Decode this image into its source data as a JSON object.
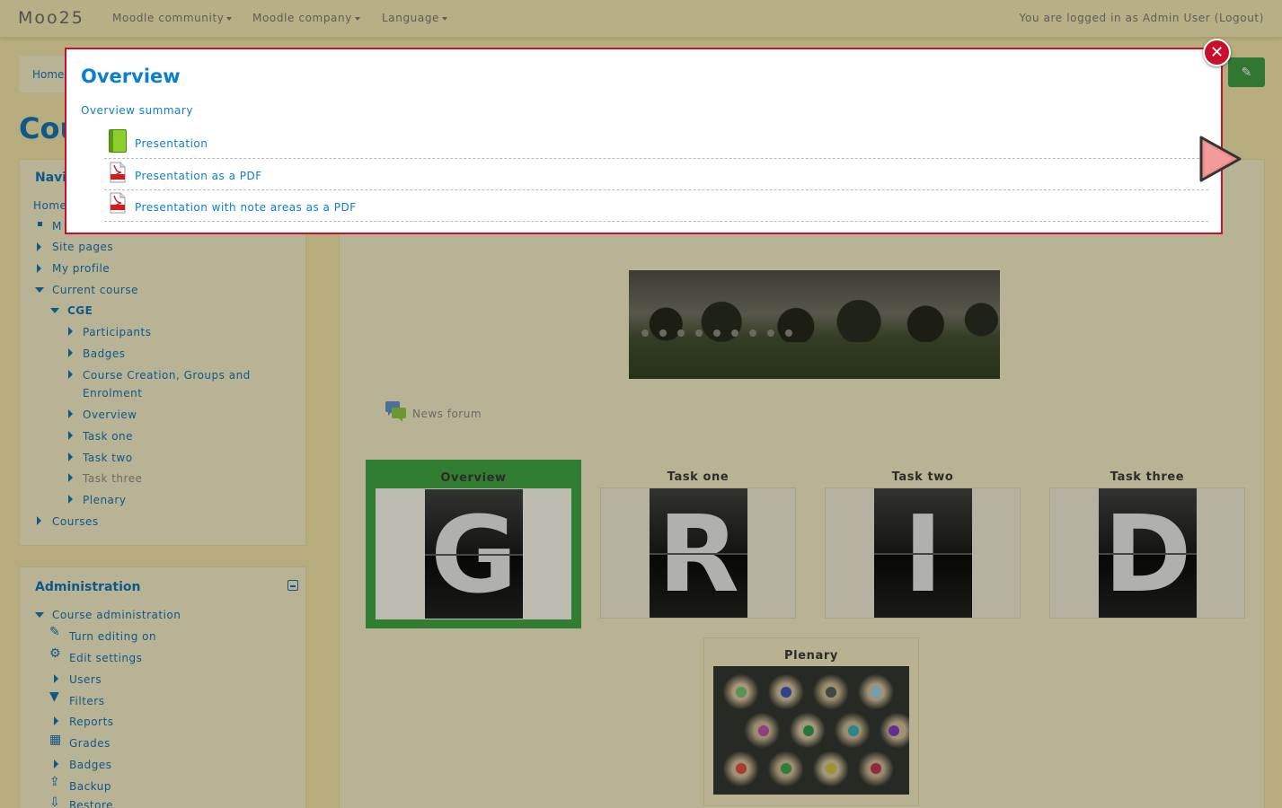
{
  "navbar": {
    "brand": "Moo25",
    "menus": [
      "Moodle community",
      "Moodle company",
      "Language"
    ],
    "login_prefix": "You are logged in as ",
    "login_user": "Admin User",
    "logout": "Logout"
  },
  "breadcrumb": {
    "home": "Home"
  },
  "course_heading": "Cou",
  "navigation": {
    "title": "Navi",
    "home": "Home",
    "my": "M",
    "site_pages": "Site pages",
    "my_profile": "My profile",
    "current_course": "Current course",
    "course_short": "CGE",
    "course_items": [
      "Participants",
      "Badges",
      "Course Creation, Groups and",
      "Enrolment",
      "Overview",
      "Task one",
      "Task two",
      "Task three",
      "Plenary"
    ],
    "courses": "Courses"
  },
  "administration": {
    "title": "Administration",
    "course_admin": "Course administration",
    "items": [
      "Turn editing on",
      "Edit settings",
      "Users",
      "Filters",
      "Reports",
      "Grades",
      "Badges",
      "Backup",
      "Restore"
    ]
  },
  "main": {
    "news_forum": "News forum",
    "tiles": [
      {
        "title": "Overview",
        "letter": "G",
        "current": true
      },
      {
        "title": "Task one",
        "letter": "R"
      },
      {
        "title": "Task two",
        "letter": "I"
      },
      {
        "title": "Task three",
        "letter": "D"
      },
      {
        "title": "Plenary"
      }
    ]
  },
  "modal": {
    "title": "Overview",
    "summary": "Overview summary",
    "activities": [
      {
        "label": "Presentation",
        "icon": "book-icon"
      },
      {
        "label": "Presentation as a PDF",
        "icon": "pdf-icon"
      },
      {
        "label": "Presentation with note areas as a PDF",
        "icon": "pdf-icon"
      }
    ],
    "close_glyph": "✕"
  },
  "colors": {
    "accent_blue": "#0a7ed0",
    "current_green": "#3aa23d",
    "modal_border": "#c8102e",
    "background": "#f1e4a6"
  }
}
